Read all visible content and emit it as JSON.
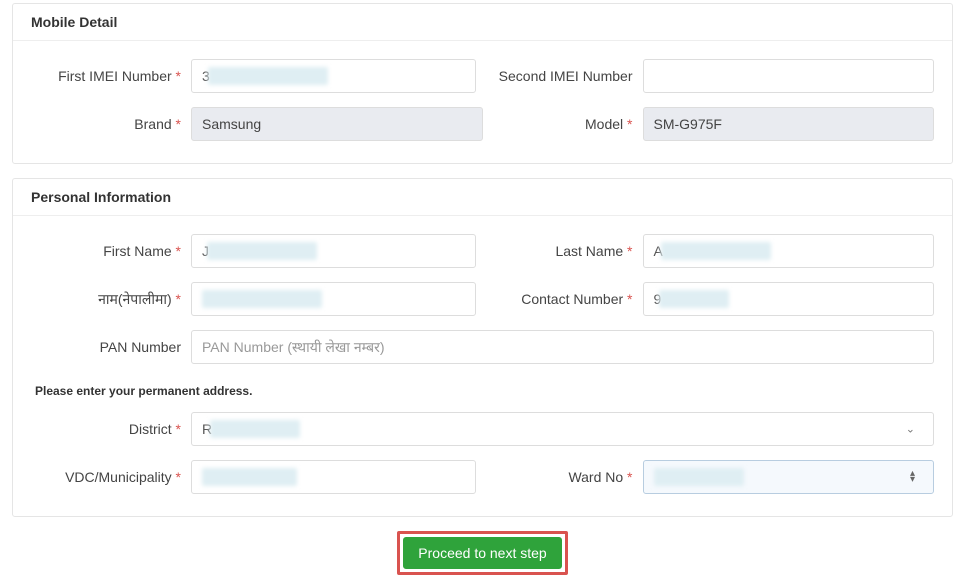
{
  "mobile": {
    "title": "Mobile Detail",
    "first_imei_label": "First IMEI Number",
    "first_imei_value": "3",
    "second_imei_label": "Second IMEI Number",
    "second_imei_value": "",
    "brand_label": "Brand",
    "brand_value": "Samsung",
    "model_label": "Model",
    "model_value": "SM-G975F"
  },
  "personal": {
    "title": "Personal Information",
    "first_name_label": "First Name",
    "first_name_value": "J",
    "last_name_label": "Last Name",
    "last_name_value": "A",
    "nepali_name_label": "नाम(नेपालीमा)",
    "nepali_name_value": "",
    "contact_label": "Contact Number",
    "contact_value": "9",
    "pan_label": "PAN Number",
    "pan_placeholder": "PAN Number (स्थायी लेखा नम्बर)",
    "pan_value": "",
    "address_helper": "Please enter your permanent address.",
    "district_label": "District",
    "district_value": "R",
    "vdc_label": "VDC/Municipality",
    "vdc_value": "",
    "ward_label": "Ward No",
    "ward_value": ""
  },
  "action": {
    "proceed_label": "Proceed to next step"
  }
}
